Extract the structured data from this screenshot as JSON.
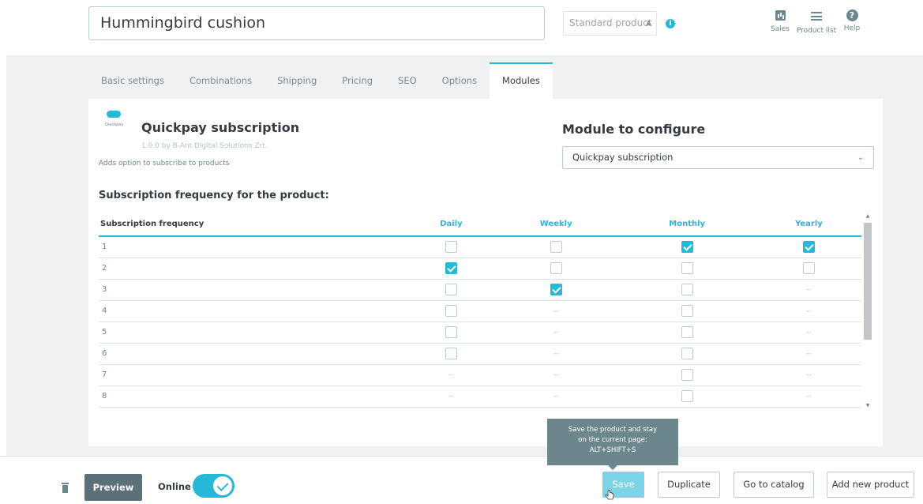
{
  "header": {
    "product_name": "Hummingbird cushion",
    "product_type": "Standard product",
    "quick_links": {
      "sales": "Sales",
      "product_list": "Product list",
      "help": "Help"
    }
  },
  "tabs": [
    "Basic settings",
    "Combinations",
    "Shipping",
    "Pricing",
    "SEO",
    "Options",
    "Modules"
  ],
  "active_tab": "Modules",
  "module": {
    "logo_text": "Quickpay",
    "title": "Quickpay subscription",
    "version": "1.0.0 by B-Ant Digital Solutions Zrt.",
    "description": "Adds option to subscribe to products"
  },
  "configure": {
    "title": "Module to configure",
    "selected": "Quickpay subscription"
  },
  "frequency": {
    "heading": "Subscription frequency for the product:",
    "columns": [
      "Subscription frequency",
      "Daily",
      "Weekly",
      "Monthly",
      "Yearly"
    ],
    "rows": [
      {
        "label": "1",
        "cells": [
          "off",
          "off",
          "on",
          "on"
        ]
      },
      {
        "label": "2",
        "cells": [
          "on",
          "off",
          "off",
          "off"
        ]
      },
      {
        "label": "3",
        "cells": [
          "off",
          "on",
          "off",
          "--"
        ]
      },
      {
        "label": "4",
        "cells": [
          "off",
          "--",
          "off",
          "--"
        ]
      },
      {
        "label": "5",
        "cells": [
          "off",
          "--",
          "off",
          "--"
        ]
      },
      {
        "label": "6",
        "cells": [
          "off",
          "--",
          "off",
          "--"
        ]
      },
      {
        "label": "7",
        "cells": [
          "--",
          "--",
          "off",
          "--"
        ]
      },
      {
        "label": "8",
        "cells": [
          "--",
          "--",
          "off",
          "--"
        ]
      }
    ]
  },
  "footer": {
    "preview": "Preview",
    "online": "Online",
    "save": "Save",
    "duplicate": "Duplicate",
    "go_to_catalog": "Go to catalog",
    "add_new_product": "Add new product",
    "tooltip_line1": "Save the product and stay",
    "tooltip_line2": "on the current page:",
    "tooltip_line3": "ALT+SHIFT+S"
  },
  "colors": {
    "accent": "#25b9d7",
    "dark": "#363a41",
    "muted": "#6c868e"
  }
}
